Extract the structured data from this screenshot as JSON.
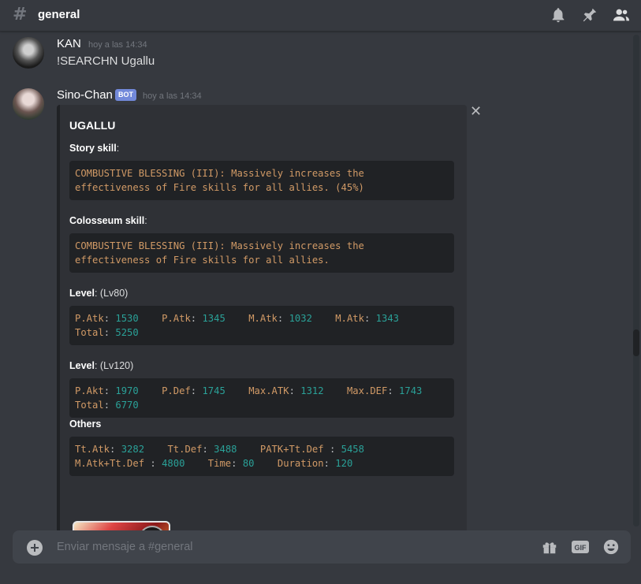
{
  "channel": {
    "name": "general"
  },
  "messages": [
    {
      "username": "KAN",
      "timestamp": "hoy a las 14:34",
      "text": "!SEARCHN Ugallu"
    },
    {
      "username": "Sino-Chan",
      "bot_tag": "BOT",
      "timestamp": "hoy a las 14:34"
    }
  ],
  "embed": {
    "close": "✕",
    "title": "UGALLU",
    "story_skill": {
      "name": "Story skill",
      "suffix": ":",
      "lines": [
        "COMBUSTIVE BLESSING (III): Massively increases the",
        "effectiveness of Fire skills for all allies. (45%)"
      ]
    },
    "colosseum_skill": {
      "name": "Colosseum skill",
      "suffix": ":",
      "lines": [
        "COMBUSTIVE BLESSING (III): Massively increases the",
        "effectiveness of Fire skills for all allies."
      ]
    },
    "level80": {
      "name": "Level",
      "value": ": (Lv80)",
      "row1": [
        {
          "k": "P.Atk",
          "v": "1530"
        },
        {
          "k": "P.Atk",
          "v": "1345"
        },
        {
          "k": "M.Atk",
          "v": "1032"
        },
        {
          "k": "M.Atk",
          "v": "1343"
        }
      ],
      "total_label": "Total",
      "total_value": "5250"
    },
    "level120": {
      "name": "Level",
      "value": ": (Lv120)",
      "row1": [
        {
          "k": "P.Akt",
          "v": "1970"
        },
        {
          "k": "P.Def",
          "v": "1745"
        },
        {
          "k": "Max.ATK",
          "v": "1312"
        },
        {
          "k": "Max.DEF",
          "v": "1743"
        }
      ],
      "total_label": "Total",
      "total_value": "6770"
    },
    "others": {
      "name": "Others",
      "row1": [
        {
          "k": "Tt.Atk",
          "v": "3282"
        },
        {
          "k": "Tt.Def",
          "v": "3488"
        },
        {
          "k": "PATK+Tt.Def ",
          "v": "5458"
        }
      ],
      "row2": [
        {
          "k": "M.Atk+Tt.Def ",
          "v": "4800"
        },
        {
          "k": "Time",
          "v": "80"
        },
        {
          "k": "Duration",
          "v": "120"
        }
      ]
    }
  },
  "composer": {
    "placeholder": "Enviar mensaje a #general"
  },
  "icons": {
    "top": [
      "bell-icon",
      "pin-icon",
      "members-icon"
    ],
    "composer": [
      "gift-icon",
      "gif-icon",
      "emoji-icon"
    ]
  },
  "colors": {
    "background": "#36393f",
    "embed_bg": "#2f3136",
    "code_bg": "#202225",
    "code_key": "#d19a66",
    "code_value": "#2aa198",
    "bot_tag": "#7289da"
  }
}
